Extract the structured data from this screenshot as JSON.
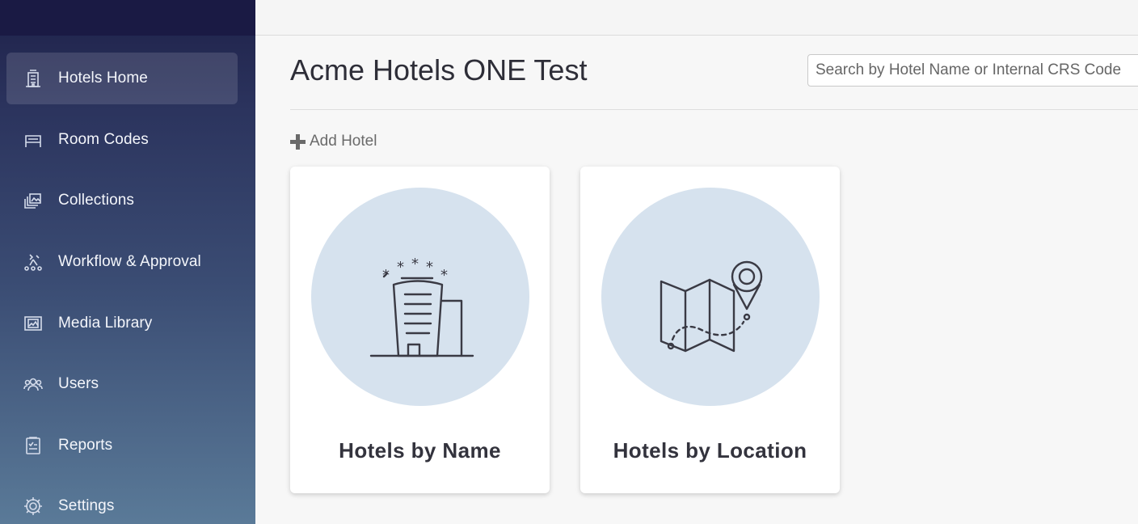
{
  "sidebar": {
    "items": [
      {
        "label": "Hotels Home",
        "icon": "hotel-icon",
        "active": true
      },
      {
        "label": "Room Codes",
        "icon": "bed-icon",
        "active": false
      },
      {
        "label": "Collections",
        "icon": "collections-icon",
        "active": false
      },
      {
        "label": "Workflow & Approval",
        "icon": "workflow-icon",
        "active": false
      },
      {
        "label": "Media Library",
        "icon": "media-icon",
        "active": false
      },
      {
        "label": "Users",
        "icon": "users-icon",
        "active": false
      },
      {
        "label": "Reports",
        "icon": "reports-icon",
        "active": false
      },
      {
        "label": "Settings",
        "icon": "gear-icon",
        "active": false
      }
    ]
  },
  "main": {
    "title": "Acme Hotels ONE Test",
    "search": {
      "placeholder": "Search by Hotel Name or Internal CRS Code",
      "value": ""
    },
    "add_hotel_label": "Add Hotel",
    "cards": [
      {
        "label": "Hotels by Name",
        "icon": "hotel-building-icon"
      },
      {
        "label": "Hotels by Location",
        "icon": "map-pin-icon"
      }
    ]
  },
  "colors": {
    "sidebar_top": "#1a1a44",
    "sidebar_bottom": "#5a7a98",
    "card_circle": "#d6e2ee",
    "background": "#f7f7f7"
  }
}
